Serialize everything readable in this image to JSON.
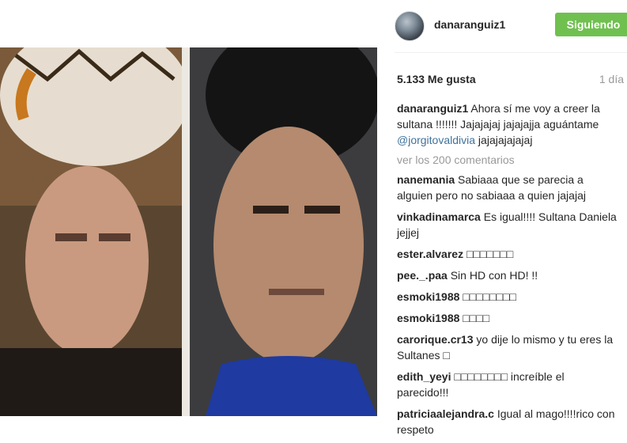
{
  "post": {
    "username": "danaranguiz1",
    "follow_label": "Siguiendo",
    "likes": "5.133 Me gusta",
    "time_ago": "1 día",
    "caption": {
      "user": "danaranguiz1",
      "text_before": "Ahora sí me voy a creer la sultana !!!!!!! Jajajajaj jajajajja aguántame ",
      "mention": "@jorgitovaldivia",
      "text_after": " jajajajajajaj"
    },
    "view_all": "ver los 200 comentarios",
    "comments": [
      {
        "user": "nanemania",
        "text": "Sabiaaa que se parecia a alguien pero no sabiaaa a quien jajajaj"
      },
      {
        "user": "vinkadinamarca",
        "text": "Es igual!!!! Sultana Daniela jejjej"
      },
      {
        "user": "ester.alvarez",
        "text": "□□□□□□□"
      },
      {
        "user": "pee._.paa",
        "text": "Sin HD con HD! !!"
      },
      {
        "user": "esmoki1988",
        "text": "□□□□□□□□"
      },
      {
        "user": "esmoki1988",
        "text": "□□□□"
      },
      {
        "user": "carorique.cr13",
        "text": "yo dije lo mismo y tu eres la Sultanes □"
      },
      {
        "user": "edith_yeyi",
        "text": "□□□□□□□□ increíble el parecido!!!"
      },
      {
        "user": "patriciaalejandra.c",
        "text": "Igual al mago!!!!rico con respeto"
      }
    ]
  }
}
